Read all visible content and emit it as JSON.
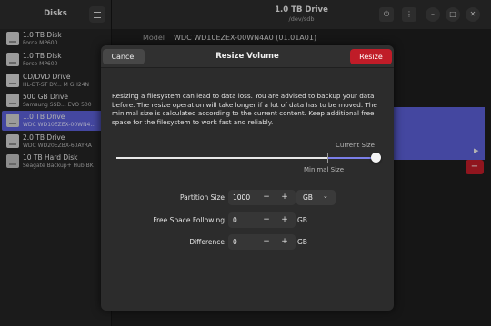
{
  "sidebar": {
    "title": "Disks",
    "drives": [
      {
        "name": "1.0 TB Disk",
        "sub": "Force MP600",
        "icon": "disk-icon"
      },
      {
        "name": "1.0 TB Disk",
        "sub": "Force MP600",
        "icon": "disk-icon"
      },
      {
        "name": "CD/DVD Drive",
        "sub": "HL-DT-ST DV... M GH24N",
        "icon": "optical-drive-icon"
      },
      {
        "name": "500 GB Drive",
        "sub": "Samsung SSD... EVO 500",
        "icon": "disk-icon"
      },
      {
        "name": "1.0 TB Drive",
        "sub": "WDC WD10EZEX-00WN4...",
        "icon": "disk-icon",
        "selected": true
      },
      {
        "name": "2.0 TB Drive",
        "sub": "WDC WD20EZBX-60AYRA",
        "icon": "disk-icon"
      },
      {
        "name": "10 TB Hard Disk",
        "sub": "Seagate Backup+ Hub BK",
        "icon": "usb-drive-icon"
      }
    ]
  },
  "header": {
    "title": "1.0 TB Drive",
    "subtitle": "/dev/sdb",
    "icons": [
      "power-icon",
      "kebab-menu-icon",
      "minimize-icon",
      "maximize-icon",
      "close-icon"
    ]
  },
  "details": {
    "model_label": "Model",
    "model_value": "WDC WD10EZEX-00WN4A0 (01.01A01)",
    "partition_arrow": "▶",
    "delete_glyph": "−"
  },
  "dialog": {
    "title": "Resize Volume",
    "cancel_label": "Cancel",
    "resize_label": "Resize",
    "description": "Resizing a filesystem can lead to data loss. You are advised to backup your data before. The resize operation will take longer if a lot of data has to be moved. The minimal size is calculated according to the current content. Keep additional free space for the filesystem to work fast and reliably.",
    "current_size_label": "Current Size",
    "minimal_size_label": "Minimal Size",
    "slider_value_fraction": 1.0,
    "slider_min_fraction": 0.81,
    "fields": {
      "partition_size": {
        "label": "Partition Size",
        "value": "1000",
        "unit": "GB"
      },
      "free_space": {
        "label": "Free Space Following",
        "value": "0",
        "unit": "GB"
      },
      "difference": {
        "label": "Difference",
        "value": "0",
        "unit": "GB"
      }
    },
    "minus_glyph": "−",
    "plus_glyph": "+"
  },
  "colors": {
    "accent": "#5b5fd6",
    "destructive": "#c01c28",
    "dialog_bg": "#2c2c2c",
    "window_bg": "#1e1e1e"
  }
}
